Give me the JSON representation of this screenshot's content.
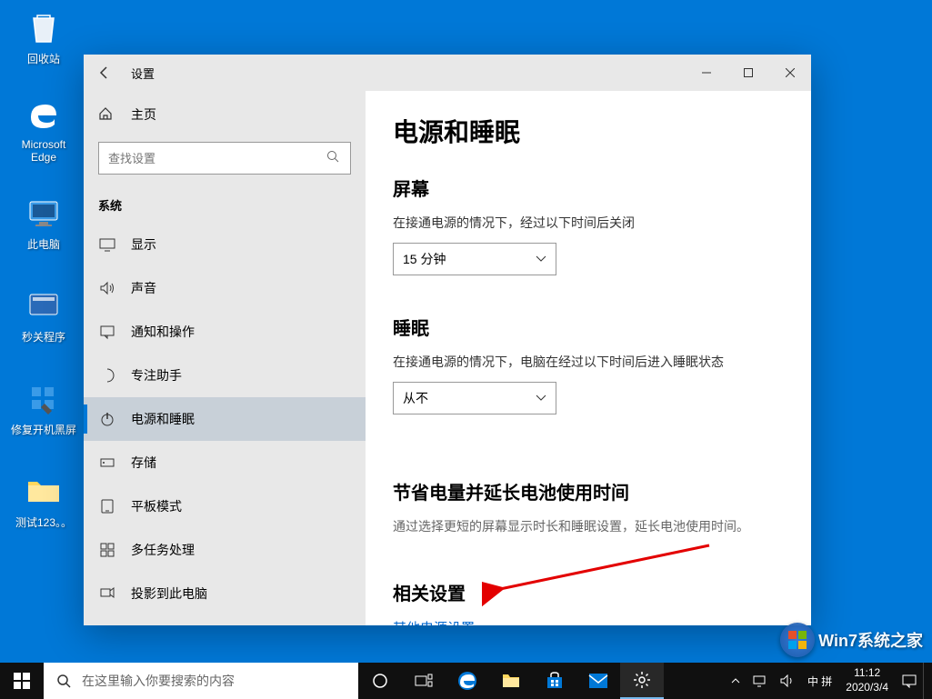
{
  "desktop": {
    "icons": [
      {
        "name": "recycle-bin",
        "label": "回收站"
      },
      {
        "name": "edge",
        "label": "Microsoft Edge"
      },
      {
        "name": "this-pc",
        "label": "此电脑"
      },
      {
        "name": "quick-close",
        "label": "秒关程序"
      },
      {
        "name": "fix-black",
        "label": "修复开机黑屏"
      },
      {
        "name": "test-folder",
        "label": "测试123。。"
      }
    ]
  },
  "window": {
    "title": "设置",
    "home": "主页",
    "search_placeholder": "查找设置",
    "category": "系统",
    "nav": [
      {
        "label": "显示",
        "icon": "display"
      },
      {
        "label": "声音",
        "icon": "sound"
      },
      {
        "label": "通知和操作",
        "icon": "notifications"
      },
      {
        "label": "专注助手",
        "icon": "focus"
      },
      {
        "label": "电源和睡眠",
        "icon": "power",
        "active": true
      },
      {
        "label": "存储",
        "icon": "storage"
      },
      {
        "label": "平板模式",
        "icon": "tablet"
      },
      {
        "label": "多任务处理",
        "icon": "multitask"
      },
      {
        "label": "投影到此电脑",
        "icon": "project"
      }
    ]
  },
  "content": {
    "title": "电源和睡眠",
    "screen_header": "屏幕",
    "screen_desc": "在接通电源的情况下，经过以下时间后关闭",
    "screen_value": "15 分钟",
    "sleep_header": "睡眠",
    "sleep_desc": "在接通电源的情况下，电脑在经过以下时间后进入睡眠状态",
    "sleep_value": "从不",
    "save_header": "节省电量并延长电池使用时间",
    "save_desc": "通过选择更短的屏幕显示时长和睡眠设置，延长电池使用时间。",
    "related_header": "相关设置",
    "related_link": "其他电源设置"
  },
  "taskbar": {
    "search_placeholder": "在这里输入你要搜索的内容",
    "ime": "中 拼",
    "time": "11:12",
    "date": "2020/3/4"
  },
  "watermark": {
    "text": "Win7系统之家"
  }
}
